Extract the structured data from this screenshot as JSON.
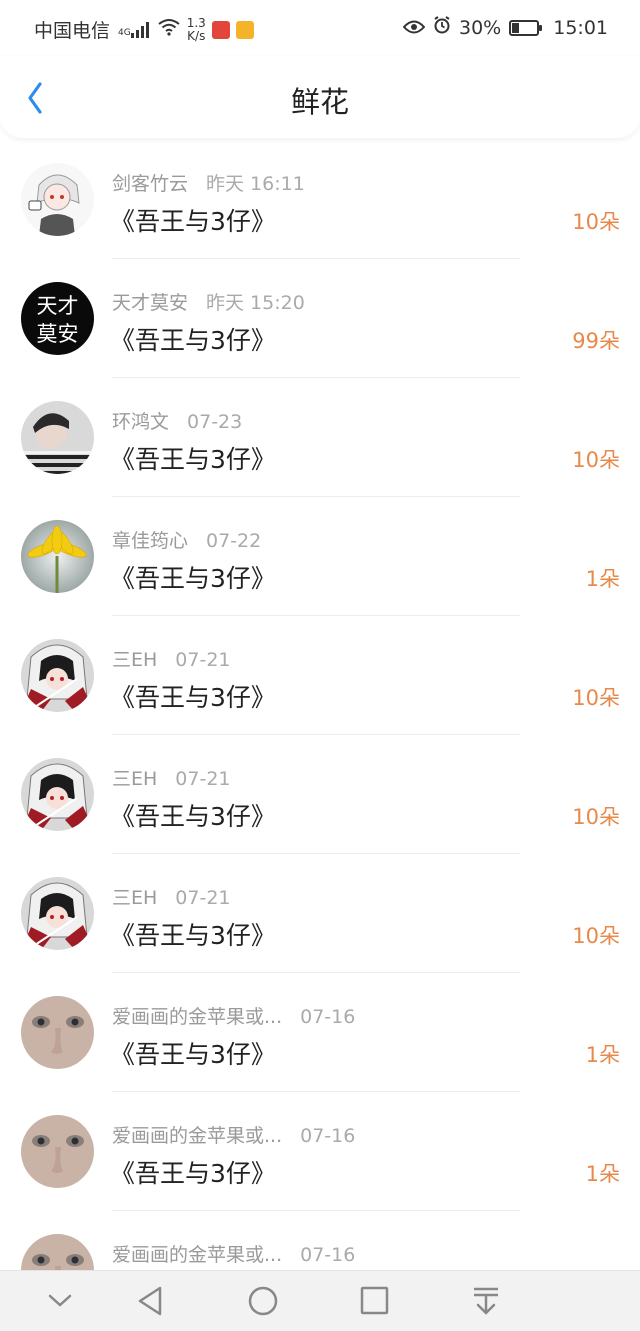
{
  "status_bar": {
    "carrier": "中国电信",
    "network_gen": "4G",
    "net_speed": "1.3",
    "net_speed_unit": "K/s",
    "battery_percent": "30%",
    "battery_level": 0.3,
    "time": "15:01"
  },
  "header": {
    "title": "鲜花",
    "back_icon": "chevron-left-icon"
  },
  "list": {
    "items": [
      {
        "name": "剑客竹云",
        "date": "昨天 16:11",
        "book": "《吾王与3仔》",
        "amount": "10朵",
        "avatar": "anime-sketch"
      },
      {
        "name": "天才莫安",
        "date": "昨天 15:20",
        "book": "《吾王与3仔》",
        "amount": "99朵",
        "avatar": "calligraphy",
        "avatar_text_1": "天才",
        "avatar_text_2": "莫安"
      },
      {
        "name": "环鸿文",
        "date": "07-23",
        "book": "《吾王与3仔》",
        "amount": "10朵",
        "avatar": "photo-person"
      },
      {
        "name": "章佳筠心",
        "date": "07-22",
        "book": "《吾王与3仔》",
        "amount": "1朵",
        "avatar": "yellow-flower"
      },
      {
        "name": "三EH",
        "date": "07-21",
        "book": "《吾王与3仔》",
        "amount": "10朵",
        "avatar": "anime-red"
      },
      {
        "name": "三EH",
        "date": "07-21",
        "book": "《吾王与3仔》",
        "amount": "10朵",
        "avatar": "anime-red"
      },
      {
        "name": "三EH",
        "date": "07-21",
        "book": "《吾王与3仔》",
        "amount": "10朵",
        "avatar": "anime-red"
      },
      {
        "name": "爱画画的金苹果或...",
        "date": "07-16",
        "book": "《吾王与3仔》",
        "amount": "1朵",
        "avatar": "face-closeup"
      },
      {
        "name": "爱画画的金苹果或...",
        "date": "07-16",
        "book": "《吾王与3仔》",
        "amount": "1朵",
        "avatar": "face-closeup"
      },
      {
        "name": "爱画画的金苹果或...",
        "date": "07-16",
        "book": "",
        "amount": "",
        "avatar": "face-closeup"
      }
    ]
  },
  "nav_bar": {
    "icons": [
      "chevron-down-icon",
      "back-triangle-icon",
      "home-circle-icon",
      "recents-square-icon",
      "pull-down-icon"
    ]
  },
  "colors": {
    "accent_blue": "#2d8cf0",
    "amount_orange": "#e8894a"
  }
}
